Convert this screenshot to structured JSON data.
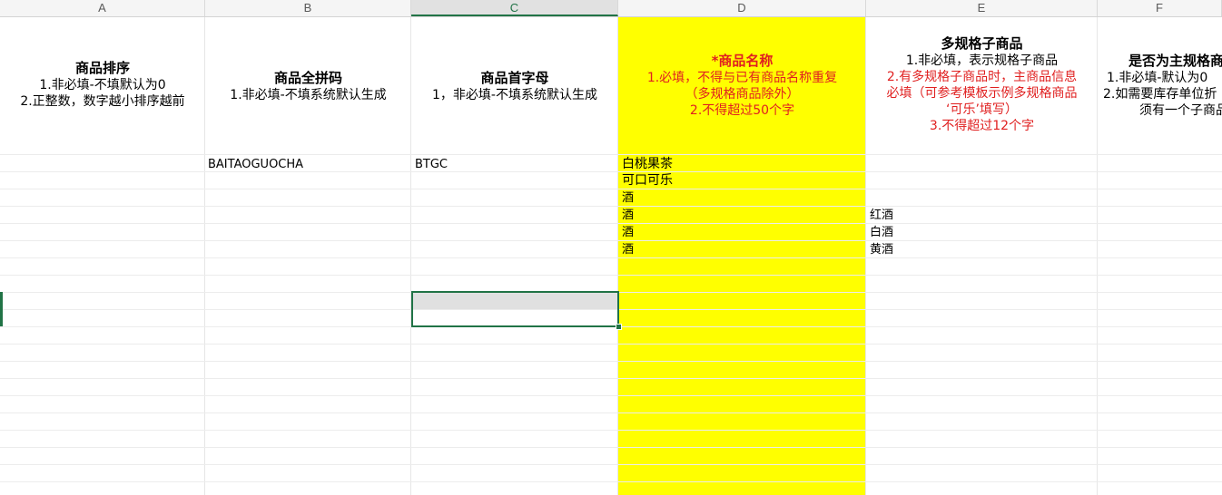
{
  "columns": [
    "A",
    "B",
    "C",
    "D",
    "E",
    "F"
  ],
  "headers": {
    "A": {
      "title": "商品排序",
      "lines": [
        "1.非必填-不填默认为0",
        "2.正整数，数字越小排序越前"
      ]
    },
    "B": {
      "title": "商品全拼码",
      "lines": [
        "1.非必填-不填系统默认生成"
      ]
    },
    "C": {
      "title": "商品首字母",
      "lines": [
        "1，非必填-不填系统默认生成"
      ]
    },
    "D": {
      "title": "*商品名称",
      "lines": [
        "1.必填，不得与已有商品名称重复",
        "（多规格商品除外）",
        "2.不得超过50个字"
      ]
    },
    "E": {
      "title": "多规格子商品",
      "line1": "1.非必填，表示规格子商品",
      "red_lines": [
        "2.有多规格子商品时，主商品信息",
        "必填（可参考模板示例多规格商品",
        "‘可乐’填写）",
        "3.不得超过12个字"
      ]
    },
    "F": {
      "title": "是否为主规格商",
      "lines": [
        "1.非必填-默认为0",
        "2.如需要库存单位折",
        "须有一个子商品"
      ]
    }
  },
  "rows": [
    {
      "B": "BAITAOGUOCHA",
      "C": "BTGC",
      "D": "白桃果茶",
      "E": ""
    },
    {
      "B": "",
      "C": "",
      "D": "可口可乐",
      "E": ""
    },
    {
      "B": "",
      "C": "",
      "D": "酒",
      "E": ""
    },
    {
      "B": "",
      "C": "",
      "D": "酒",
      "E": "红酒"
    },
    {
      "B": "",
      "C": "",
      "D": "酒",
      "E": "白酒"
    },
    {
      "B": "",
      "C": "",
      "D": "酒",
      "E": "黄酒"
    }
  ],
  "selected_cell": "C",
  "colors": {
    "highlight": "#ffff00",
    "required_text": "#e02020",
    "selection": "#217346"
  }
}
